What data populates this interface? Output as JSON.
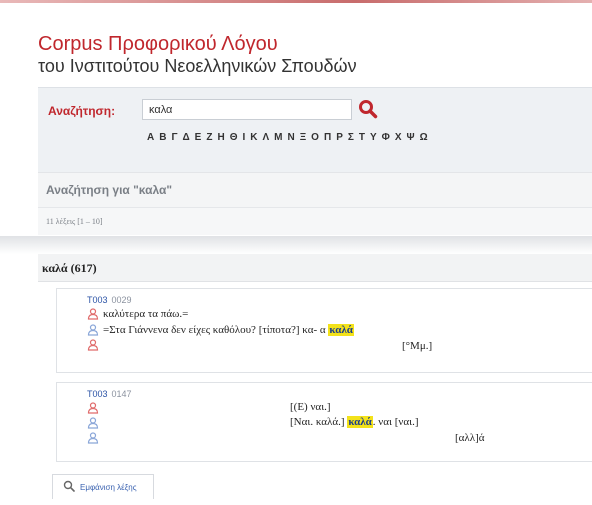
{
  "header": {
    "title_line1": "Corpus Προφορικού Λόγου",
    "title_line2": "του Ινστιτούτου Νεοελληνικών Σπουδών"
  },
  "search": {
    "label": "Αναζήτηση:",
    "value": "καλα",
    "icon": "search-icon",
    "alphabet": [
      "Α",
      "Β",
      "Γ",
      "Δ",
      "Ε",
      "Ζ",
      "Η",
      "Θ",
      "Ι",
      "Κ",
      "Λ",
      "Μ",
      "Ν",
      "Ξ",
      "Ο",
      "Π",
      "Ρ",
      "Σ",
      "Τ",
      "Υ",
      "Φ",
      "Χ",
      "Ψ",
      "Ω"
    ]
  },
  "results": {
    "title": "Αναζήτηση για \"καλα\"",
    "count": "11 λέξεις [1 – 10]"
  },
  "word": {
    "heading": "καλά (617)"
  },
  "card1": {
    "ref_id": "T003",
    "ref_num": "0029",
    "line1": "καλύτερα τα πάω.=",
    "line2_pre": "=Στα Γιάννενα δεν είχες καθόλου? [τίποτα?] κα- α",
    "line2_hl": "καλά",
    "line3": "[°Μμ.]"
  },
  "card2": {
    "ref_id": "T003",
    "ref_num": "0147",
    "line1": "[(Ε) ναι.]",
    "line2_pre": "[Ναι. καλά.]",
    "line2_hl": "καλά",
    "line2_post": ". ναι [ναι.]",
    "line3": "[αλλ]ά"
  },
  "show_button": {
    "label": "Εμφάνιση λέξης",
    "icon": "magnifier-icon"
  },
  "colors": {
    "brand": "#c0272d",
    "highlight": "#f3e21a",
    "link": "#2b53a6",
    "speaker_a": "#e06b6b",
    "speaker_b": "#8aa6d8"
  }
}
